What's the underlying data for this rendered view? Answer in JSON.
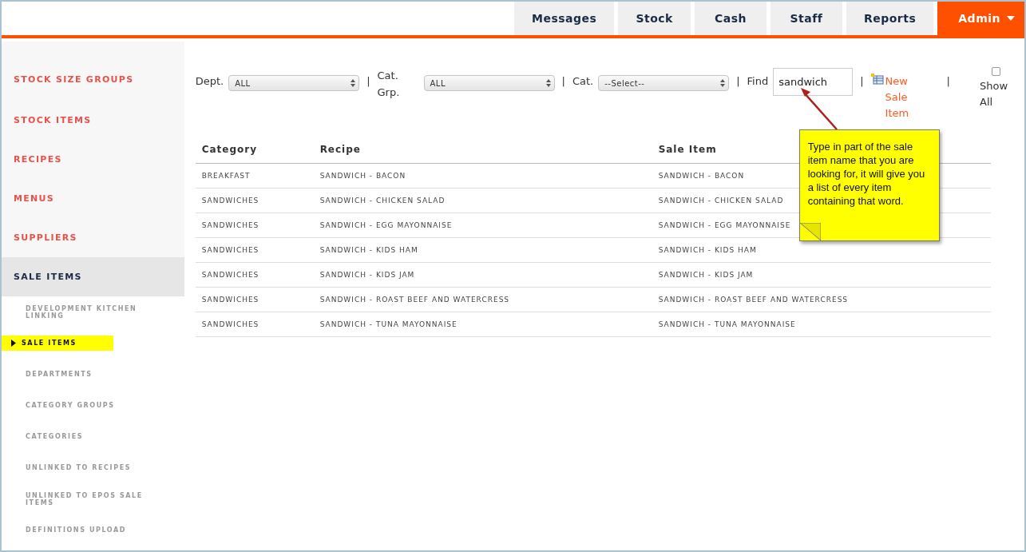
{
  "nav": {
    "tabs": [
      {
        "label": "Messages",
        "selected": false
      },
      {
        "label": "Stock",
        "selected": false
      },
      {
        "label": "Cash",
        "selected": false
      },
      {
        "label": "Staff",
        "selected": false
      },
      {
        "label": "Reports",
        "selected": false
      },
      {
        "label": "Admin",
        "selected": true
      }
    ]
  },
  "sidebar": {
    "items": [
      {
        "label": "STOCK SIZE GROUPS",
        "selected": false
      },
      {
        "label": "STOCK ITEMS",
        "selected": false
      },
      {
        "label": "RECIPES",
        "selected": false
      },
      {
        "label": "MENUS",
        "selected": false
      },
      {
        "label": "SUPPLIERS",
        "selected": false
      },
      {
        "label": "SALE ITEMS",
        "selected": true,
        "children": [
          {
            "label": "DEVELOPMENT KITCHEN LINKING",
            "selected": false
          },
          {
            "label": "SALE ITEMS",
            "selected": true
          },
          {
            "label": "DEPARTMENTS",
            "selected": false
          },
          {
            "label": "CATEGORY GROUPS",
            "selected": false
          },
          {
            "label": "CATEGORIES",
            "selected": false
          },
          {
            "label": "UNLINKED TO RECIPES",
            "selected": false
          },
          {
            "label": "UNLINKED TO EPOS SALE ITEMS",
            "selected": false
          },
          {
            "label": "DEFINITIONS UPLOAD",
            "selected": false
          }
        ]
      }
    ]
  },
  "filters": {
    "separators": [
      "|",
      "|",
      "|",
      "|",
      "|"
    ],
    "dept": {
      "label": "Dept.",
      "value": "ALL"
    },
    "cat_grp": {
      "label": "Cat. Grp.",
      "value": "ALL"
    },
    "cat": {
      "label": "Cat.",
      "value": "--Select--"
    },
    "find": {
      "label": "Find",
      "value": "sandwich"
    },
    "new_link": "New Sale Item",
    "show_all": {
      "label": "Show All",
      "checked": false
    }
  },
  "table": {
    "columns": [
      "Category",
      "Recipe",
      "Sale Item"
    ],
    "rows": [
      [
        "BREAKFAST",
        "SANDWICH - BACON",
        "SANDWICH - BACON"
      ],
      [
        "SANDWICHES",
        "SANDWICH - CHICKEN SALAD",
        "SANDWICH - CHICKEN SALAD"
      ],
      [
        "SANDWICHES",
        "SANDWICH - EGG MAYONNAISE",
        "SANDWICH - EGG MAYONNAISE"
      ],
      [
        "SANDWICHES",
        "SANDWICH - KIDS HAM",
        "SANDWICH - KIDS HAM"
      ],
      [
        "SANDWICHES",
        "SANDWICH - KIDS JAM",
        "SANDWICH - KIDS JAM"
      ],
      [
        "SANDWICHES",
        "SANDWICH - ROAST BEEF AND WATERCRESS",
        "SANDWICH - ROAST BEEF AND WATERCRESS"
      ],
      [
        "SANDWICHES",
        "SANDWICH - TUNA MAYONNAISE",
        "SANDWICH - TUNA MAYONNAISE"
      ]
    ]
  },
  "callout": {
    "text": "Type in part of the sale item name that you are looking for, it will give you a list of every item containing that word."
  }
}
